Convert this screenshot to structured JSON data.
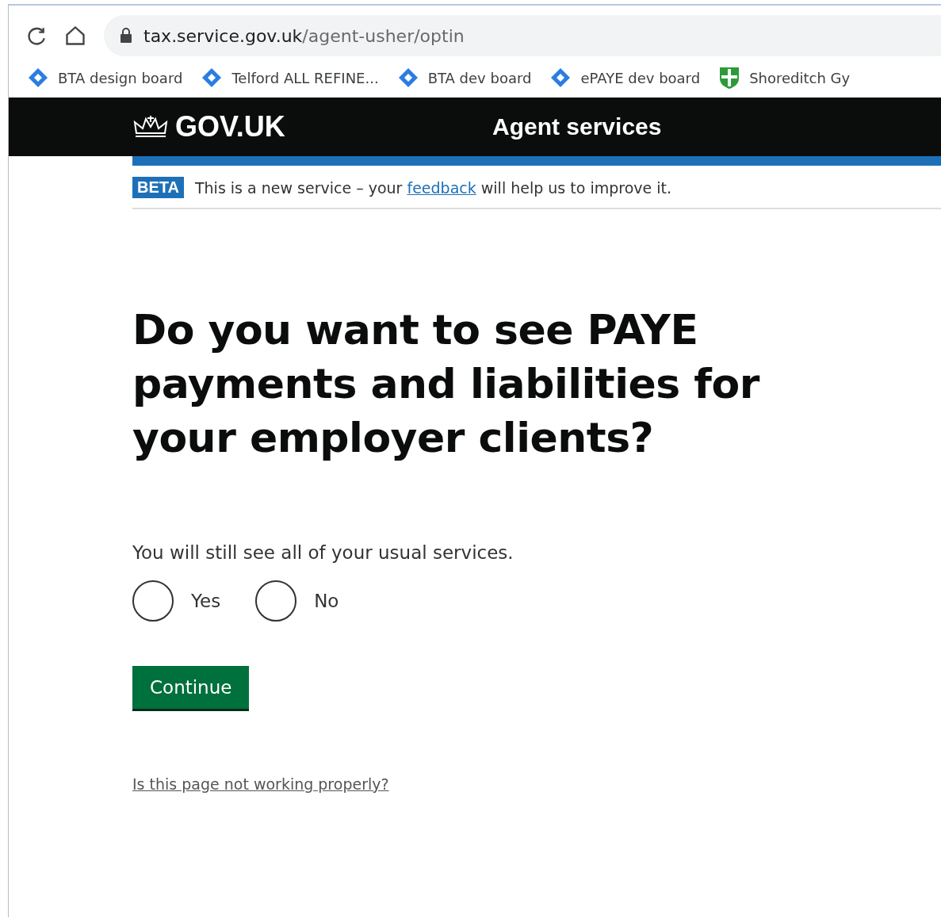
{
  "browser": {
    "url_host": "tax.service.gov.uk",
    "url_path": "/agent-usher/optin",
    "bookmarks": [
      {
        "label": "BTA design board",
        "kind": "board"
      },
      {
        "label": "Telford ALL REFINE...",
        "kind": "board"
      },
      {
        "label": "BTA dev board",
        "kind": "board"
      },
      {
        "label": "ePAYE dev board",
        "kind": "board"
      },
      {
        "label": "Shoreditch Gy",
        "kind": "shield"
      }
    ]
  },
  "header": {
    "logo": "GOV.UK",
    "service": "Agent services"
  },
  "phase_banner": {
    "tag": "BETA",
    "before": "This is a new service – your",
    "link": "feedback",
    "after": "will help us to improve it."
  },
  "question": {
    "title": "Do you want to see PAYE payments and liabilities for your employer clients?",
    "hint": "You will still see all of your usual services.",
    "options": [
      {
        "label": "Yes",
        "selected": false
      },
      {
        "label": "No",
        "selected": false
      }
    ]
  },
  "button": "Continue",
  "help_link": "Is this page not working properly?"
}
